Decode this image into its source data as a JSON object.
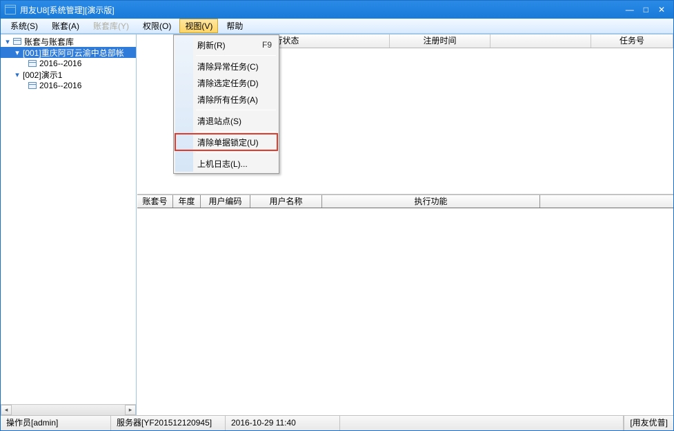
{
  "title": "用友U8[系统管理][演示版]",
  "menus": {
    "system": "系统(S)",
    "account": "账套(A)",
    "accountlib": "账套库(Y)",
    "permission": "权限(O)",
    "view": "视图(V)",
    "help": "帮助"
  },
  "tree": {
    "root": "账套与账套库",
    "items": [
      {
        "label": "[001]重庆阿可云渝中总部帐",
        "children": [
          "2016--2016"
        ]
      },
      {
        "label": "[002]演示1",
        "children": [
          "2016--2016"
        ]
      }
    ]
  },
  "upperGrid": {
    "cols": [
      "运行状态",
      "注册时间",
      "任务号"
    ]
  },
  "lowerGrid": {
    "cols": [
      "账套号",
      "年度",
      "用户编码",
      "用户名称",
      "执行功能"
    ]
  },
  "dropdown": {
    "refresh": "刷新(R)",
    "refresh_key": "F9",
    "clearAbnormal": "清除异常任务(C)",
    "clearSelected": "清除选定任务(D)",
    "clearAll": "清除所有任务(A)",
    "clearStation": "清退站点(S)",
    "clearLock": "清除单据锁定(U)",
    "log": "上机日志(L)..."
  },
  "status": {
    "operator": "操作员[admin]",
    "server": "服务器[YF201512120945]",
    "datetime": "2016-10-29 11:40",
    "brand": "[用友优普]"
  }
}
